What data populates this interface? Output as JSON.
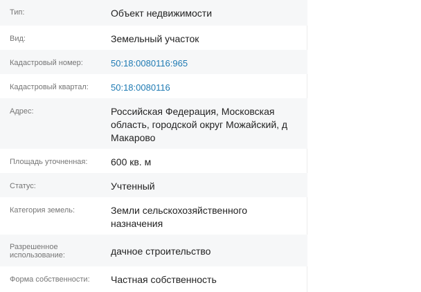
{
  "rows": [
    {
      "label": "Тип:",
      "value": "Объект недвижимости"
    },
    {
      "label": "Вид:",
      "value": "Земельный участок"
    },
    {
      "label": "Кадастровый номер:",
      "value": "50:18:0080116:965"
    },
    {
      "label": "Кадастровый квартал:",
      "value": "50:18:0080116"
    },
    {
      "label": "Адрес:",
      "value": "Российская Федерация, Московская область, городской округ Можайский, д Макарово"
    },
    {
      "label": "Площадь уточненная:",
      "value": "600 кв. м"
    },
    {
      "label": "Статус:",
      "value": "Учтенный"
    },
    {
      "label": "Категория земель:",
      "value": "Земли сельскохозяйственного назначения"
    },
    {
      "label": "Разрешенное использование:",
      "value": "дачное строительство"
    },
    {
      "label": "Форма собственности:",
      "value": "Частная собственность"
    }
  ],
  "colors": {
    "row_alt": "#f6f7f8",
    "label": "#757575",
    "value": "#222222",
    "link": "#1e7ab3"
  }
}
